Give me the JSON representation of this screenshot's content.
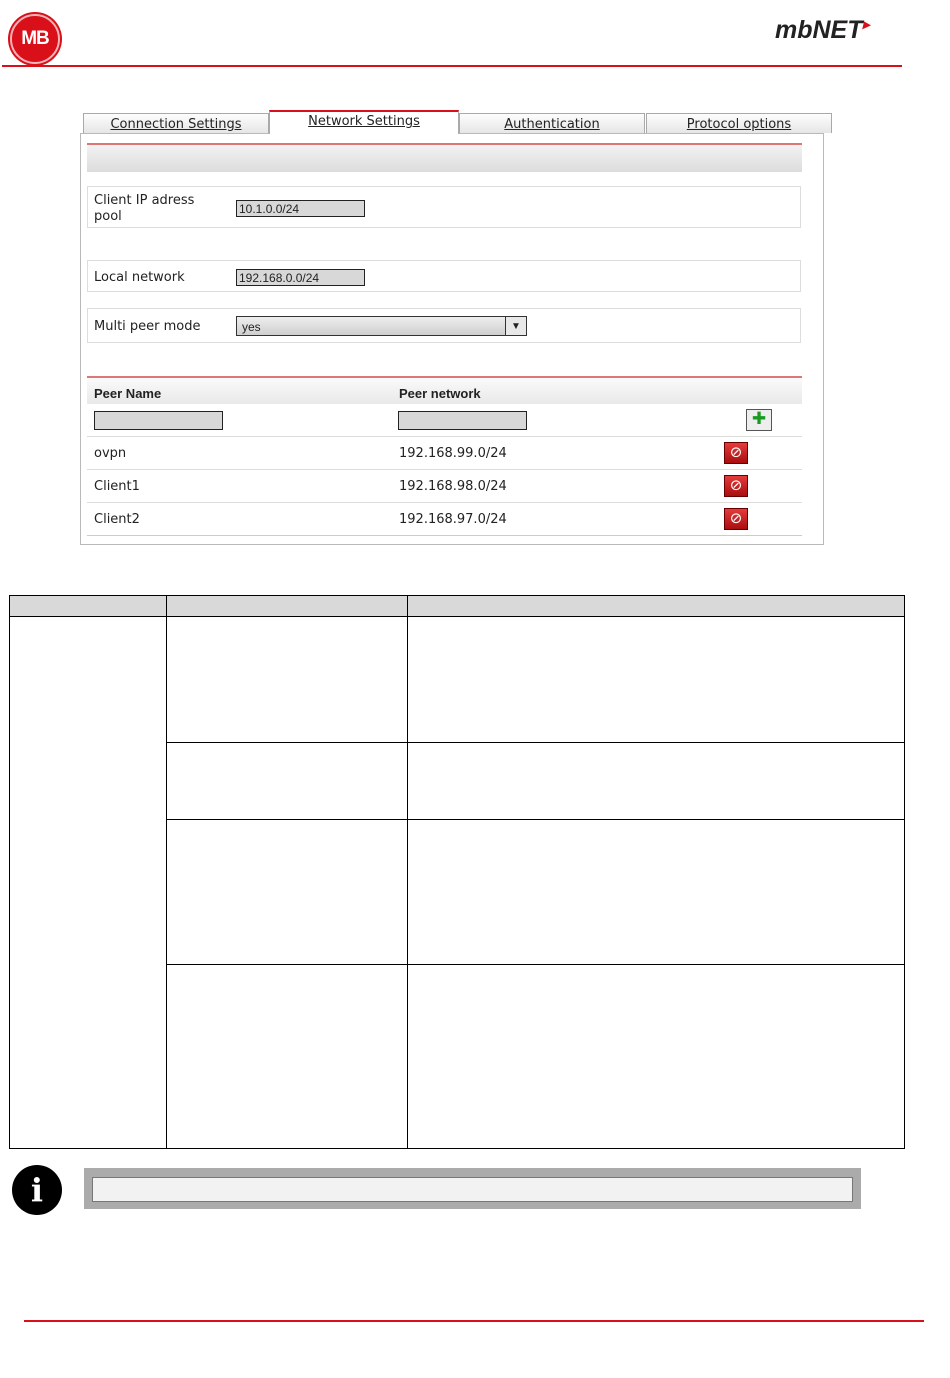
{
  "header": {
    "logo_text": "MB",
    "brand_text": "mbNET",
    "brand_mark": "·"
  },
  "tabs": [
    {
      "label": "Connection Settings",
      "active": false
    },
    {
      "label": "Network Settings",
      "active": true
    },
    {
      "label": "Authentication",
      "active": false
    },
    {
      "label": "Protocol options",
      "active": false
    }
  ],
  "form": {
    "client_ip_label_line1": "Client IP adress",
    "client_ip_label_line2": "pool",
    "client_ip_value": "10.1.0.0/24",
    "local_network_label": "Local network",
    "local_network_value": "192.168.0.0/24",
    "multi_peer_label": "Multi peer mode",
    "multi_peer_value": "yes"
  },
  "peers": {
    "columns": [
      "Peer Name",
      "Peer network"
    ],
    "new_name_value": "",
    "new_network_value": "",
    "add_icon": "add-icon",
    "delete_icon": "delete-icon",
    "rows": [
      {
        "name": "ovpn",
        "network": "192.168.99.0/24"
      },
      {
        "name": "Client1",
        "network": "192.168.98.0/24"
      },
      {
        "name": "Client2",
        "network": "192.168.97.0/24"
      }
    ]
  },
  "info": {
    "icon": "info-icon",
    "icon_glyph": "i",
    "text": ""
  },
  "colors": {
    "accent_red": "#d9101a",
    "table_header_gray": "#d9d9d9"
  }
}
